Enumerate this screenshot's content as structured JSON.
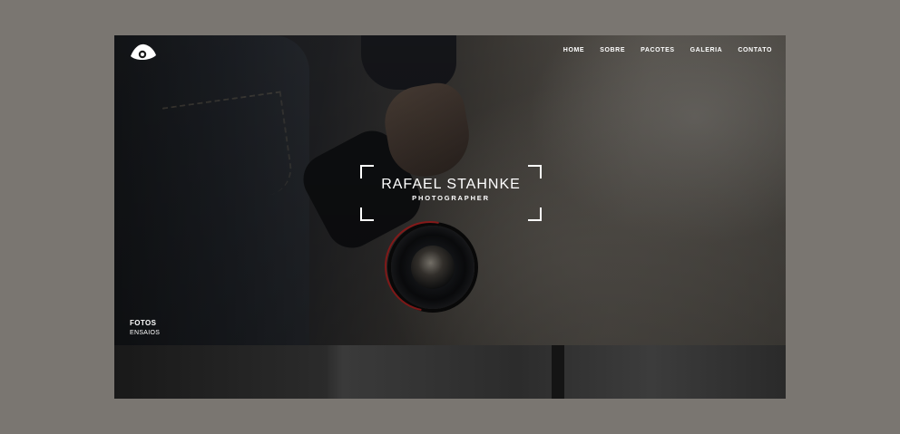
{
  "nav": {
    "items": [
      "HOME",
      "SOBRE",
      "PACOTES",
      "GALERIA",
      "CONTATO"
    ]
  },
  "logo": {
    "icon": "eye-logo-icon"
  },
  "hero": {
    "title": "RAFAEL STAHNKE",
    "subtitle": "PHOTOGRAPHER",
    "tag_primary": "FOTOS",
    "tag_secondary": "ENSAIOS"
  },
  "colors": {
    "page_background": "#7a7671",
    "text": "#ffffff",
    "lens_ring": "#a01e1e"
  }
}
